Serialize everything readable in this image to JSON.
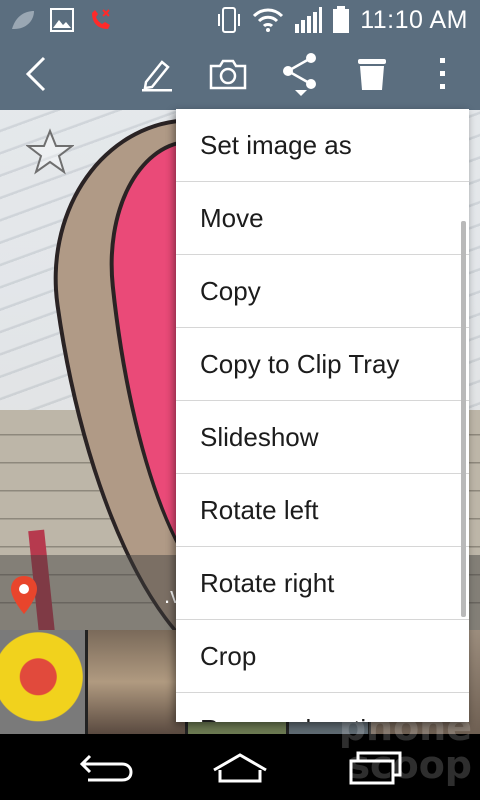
{
  "status_bar": {
    "time": "11:10 AM",
    "left_icons": [
      "leaf-icon",
      "image-notification-icon",
      "missed-call-icon"
    ],
    "right_icons": [
      "vibrate-icon",
      "wifi-icon",
      "signal-icon",
      "battery-icon"
    ]
  },
  "action_bar": {
    "icons": [
      "back-icon",
      "edit-icon",
      "camera-icon",
      "share-icon",
      "trash-icon",
      "overflow-menu-icon"
    ],
    "background": "#5b6e7f"
  },
  "photo": {
    "location_text": ".v"
  },
  "menu": {
    "items": [
      {
        "label": "Set image as"
      },
      {
        "label": "Move"
      },
      {
        "label": "Copy"
      },
      {
        "label": "Copy to Clip Tray"
      },
      {
        "label": "Slideshow"
      },
      {
        "label": "Rotate left"
      },
      {
        "label": "Rotate right"
      },
      {
        "label": "Crop"
      },
      {
        "label": "Rename location"
      }
    ]
  },
  "nav_bar": {
    "icons": [
      "nav-back-icon",
      "nav-home-icon",
      "nav-recents-icon"
    ]
  },
  "watermark": {
    "line1": "phone",
    "line2": "scoop"
  }
}
